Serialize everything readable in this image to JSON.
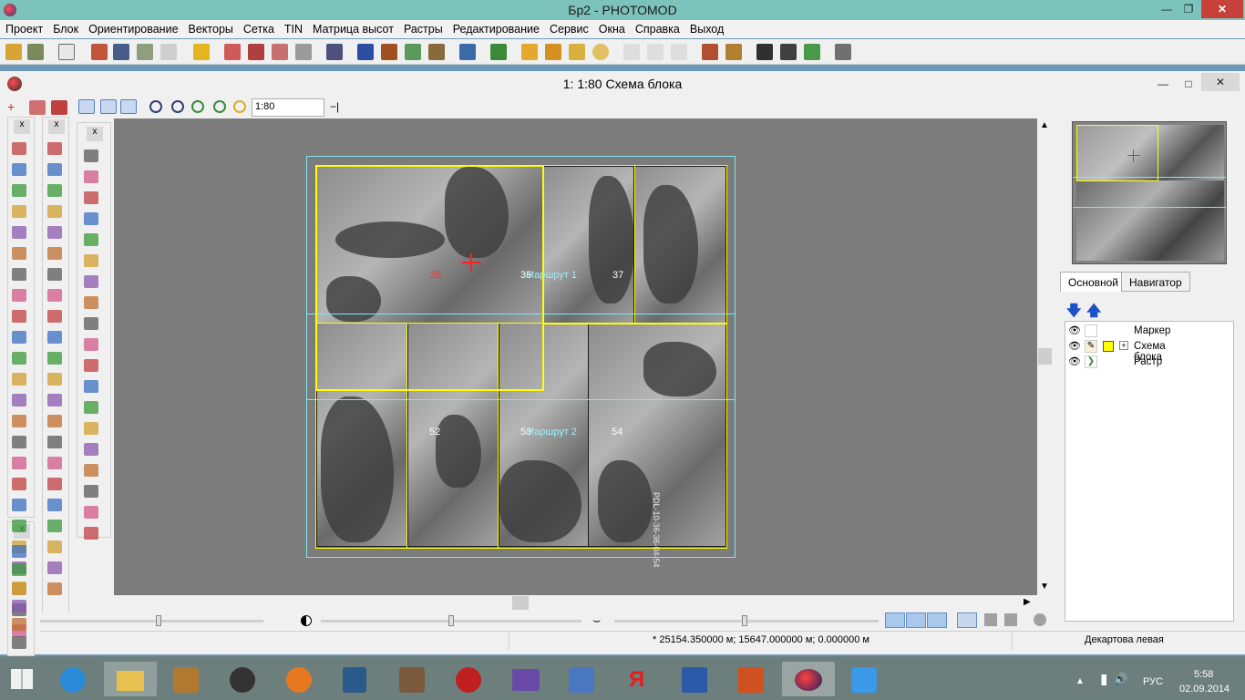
{
  "app": {
    "title": "Бр2 - PHOTOMOD"
  },
  "menu": [
    "Проект",
    "Блок",
    "Ориентирование",
    "Векторы",
    "Сетка",
    "TIN",
    "Матрица высот",
    "Растры",
    "Редактирование",
    "Сервис",
    "Окна",
    "Справка",
    "Выход"
  ],
  "inner_window": {
    "title": "1: 1:80 Схема блока",
    "scale_value": "1:80"
  },
  "canvas": {
    "photo_labels": [
      {
        "text": "35",
        "color": "#ff3030"
      },
      {
        "text": "36",
        "color": "#ffffff"
      },
      {
        "text": "37",
        "color": "#ffffff"
      },
      {
        "text": "52",
        "color": "#ffffff"
      },
      {
        "text": "53",
        "color": "#ffffff"
      },
      {
        "text": "54",
        "color": "#ffffff"
      }
    ],
    "route_labels": [
      "Маршрут 1",
      "Маршрут 2"
    ],
    "side_stamp": "PDL-10-36-36-04-54",
    "colors": {
      "selection": "#ffff00",
      "route": "#7de8f4",
      "marker": "#ff2020",
      "background": "#7c7c7c"
    }
  },
  "right_panel": {
    "tabs": [
      {
        "label": "Основной",
        "active": true
      },
      {
        "label": "Навигатор",
        "active": false
      }
    ],
    "layers": [
      {
        "label": "Маркер",
        "visible": true
      },
      {
        "label": "Схема блока",
        "visible": true,
        "color": "#ffff00"
      },
      {
        "label": "Растр",
        "visible": true
      }
    ]
  },
  "status": {
    "coords": "* 25154.350000 м; 15647.000000 м; 0.000000 м",
    "coord_system": "Декартова левая"
  },
  "taskbar": {
    "language": "РУС",
    "time": "5:58",
    "date": "02.09.2014"
  }
}
